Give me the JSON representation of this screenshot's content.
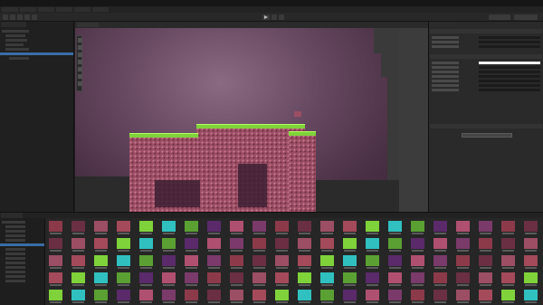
{
  "window": {
    "title": ""
  },
  "menu": {
    "items": [
      "",
      "",
      "",
      "",
      "",
      "",
      "",
      "",
      ""
    ]
  },
  "hierarchy": {
    "tab_label": "",
    "rows": [
      "",
      "",
      "",
      "",
      "",
      "",
      "",
      "",
      "",
      ""
    ]
  },
  "scene": {
    "tab_label": ""
  },
  "inspector": {
    "tab_label": "",
    "section_header": "",
    "fields": [
      {
        "label": "",
        "value": ""
      },
      {
        "label": "",
        "value": ""
      },
      {
        "label": "",
        "value": ""
      },
      {
        "label": "",
        "value": ""
      },
      {
        "label": "",
        "value": ""
      },
      {
        "label": "",
        "value": ""
      },
      {
        "label": "",
        "value": ""
      },
      {
        "label": "",
        "value": ""
      },
      {
        "label": "",
        "value": ""
      },
      {
        "label": "",
        "value": ""
      }
    ],
    "add_component_label": ""
  },
  "project": {
    "tab_label": "",
    "tree_rows": [
      "",
      "",
      "",
      "",
      "",
      "",
      "",
      "",
      "",
      "",
      "",
      "",
      "",
      ""
    ],
    "asset_colors": [
      "#8c3a4a",
      "#a44a5a",
      "#5aa032",
      "#7a3a6a",
      "#9c4e64",
      "#30c0c0",
      "#b05070",
      "#6a2f42",
      "#7fd23a",
      "#5a2a6a"
    ]
  },
  "colors": {
    "accent": "#3a6ea5",
    "grass": "#7fd23a",
    "rock": "#9c4e64",
    "sky": "#6a4c64"
  }
}
